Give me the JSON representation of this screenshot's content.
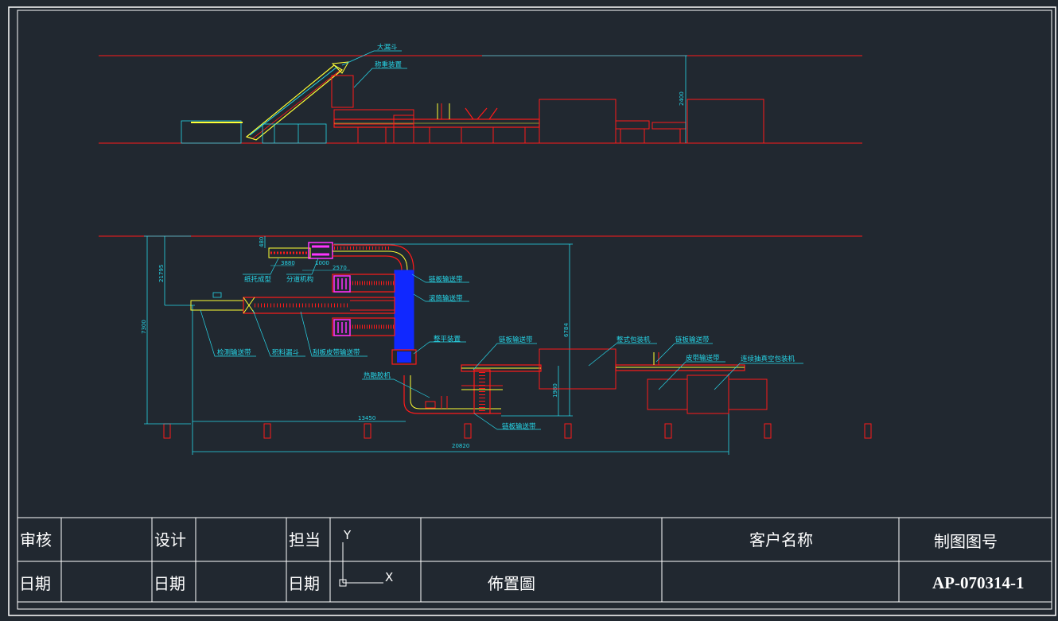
{
  "top_view": {
    "labels": {
      "big_hopper": "大漏斗",
      "weighing_device": "称重装置",
      "height_dim": "2400"
    }
  },
  "plan_view": {
    "labels": {
      "tray_former": "纸托成型",
      "lane_divider": "分道机构",
      "chain_conveyor_1": "链板输送带",
      "roller_conveyor": "滚筒输送带",
      "leveling_device": "整平装置",
      "chain_conveyor_2": "链板输送带",
      "pillow_packer": "整式包装机",
      "chain_conveyor_3": "链板输送带",
      "belt_conveyor": "皮带输送带",
      "vacuum_packer": "连续抽真空包装机",
      "hot_glue": "热融胶机",
      "chain_conveyor_bottom": "链板输送带",
      "inspection_conveyor": "检测输送带",
      "accumulation_hopper": "积料漏斗",
      "scraper_belt": "刮板皮带输送带"
    },
    "dims": {
      "d_21795": "21795",
      "d_7300": "7300",
      "d_480": "480",
      "d_3880": "3880",
      "d_1000": "1000",
      "d_2570": "2570",
      "d_6784": "6784",
      "d_1980": "1980",
      "d_13450": "13450",
      "d_20820": "20820"
    }
  },
  "title_block": {
    "review": "审核",
    "design": "设计",
    "responsible": "担当",
    "date1": "日期",
    "date2": "日期",
    "date3": "日期",
    "axis_y": "Y",
    "axis_x": "X",
    "customer_name": "客户名称",
    "drawing_no_label": "制图图号",
    "drawing_title": "佈置圖",
    "drawing_no": "AP-070314-1"
  },
  "colors": {
    "background": "#212830",
    "frame": "#ffffff",
    "red": "#ff1a1a",
    "cyan": "#27d6e8",
    "yellow": "#ffff33",
    "blue": "#1028ff",
    "magenta": "#ff33ff"
  }
}
